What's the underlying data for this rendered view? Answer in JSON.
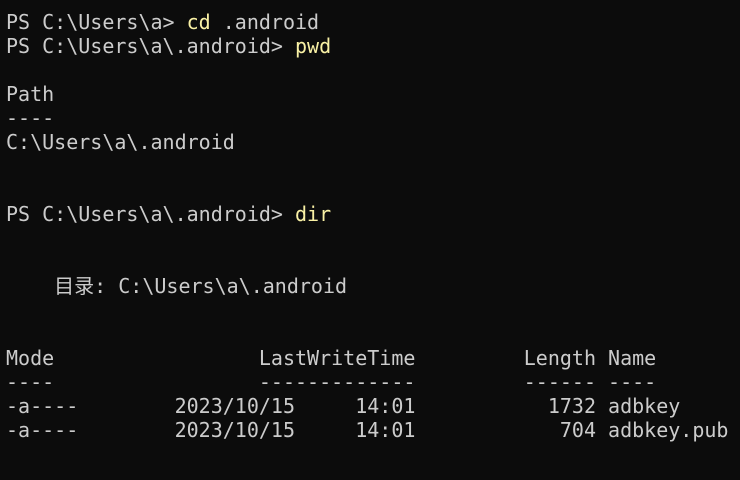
{
  "terminal": {
    "lines": {
      "l0_prompt": "PS C:\\Users\\a> ",
      "l0_cmd": "cd",
      "l0_arg": " .android",
      "l1_prompt": "PS C:\\Users\\a\\.android> ",
      "l1_cmd": "pwd",
      "l3": "Path",
      "l4": "----",
      "l5": "C:\\Users\\a\\.android",
      "l8_prompt": "PS C:\\Users\\a\\.android> ",
      "l8_cmd": "dir",
      "l11": "    目录: C:\\Users\\a\\.android",
      "l14": "Mode                 LastWriteTime         Length Name",
      "l15": "----                 -------------         ------ ----",
      "l16": "-a----        2023/10/15     14:01           1732 adbkey",
      "l17": "-a----        2023/10/15     14:01            704 adbkey.pub"
    }
  },
  "colors": {
    "background": "#0c0c0c",
    "text": "#cccccc",
    "command": "#f9f1a5"
  }
}
